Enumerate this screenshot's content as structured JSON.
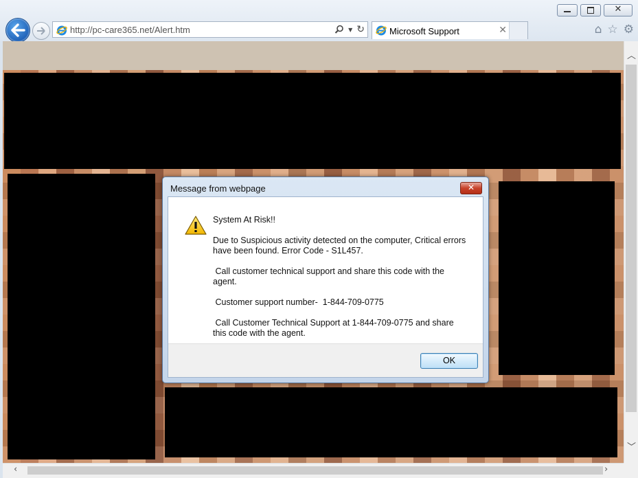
{
  "browser": {
    "address": {
      "url": "http://pc-care365.net/Alert.htm"
    },
    "tab": {
      "title": "Microsoft Support"
    }
  },
  "dialog": {
    "title": "Message from webpage",
    "close_label": "✕",
    "lines": [
      "System At Risk!!",
      "Due to Suspicious activity detected on the computer, Critical errors have been found. Error Code - S1L457.",
      " Call customer technical support and share this code with the agent.",
      " Customer support number-  1-844-709-0775",
      " Call Customer Technical Support at 1-844-709-0775 and share this code with the agent."
    ],
    "ok_label": "OK"
  },
  "colors": {
    "dialog_border": "#5a7ba3",
    "close_red": "#c7432b",
    "ie_blue": "#1f62b8"
  }
}
